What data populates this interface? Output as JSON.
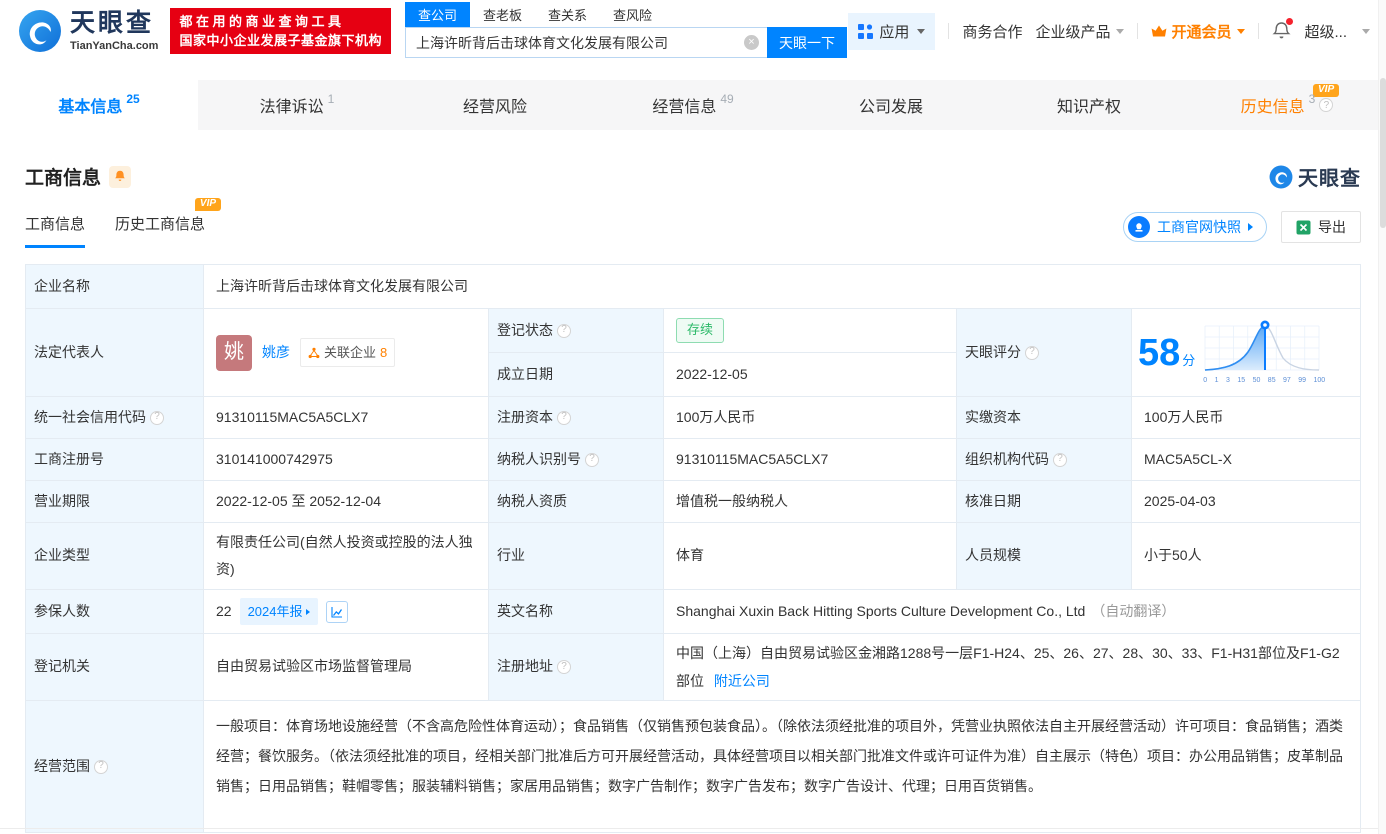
{
  "icons": {
    "help": "?",
    "clear": "×"
  },
  "badges": {
    "vip": "VIP"
  },
  "header": {
    "logo_title": "天眼查",
    "logo_domain": "TianYanCha.com",
    "banner_line1": "都在用的商业查询工具",
    "banner_line2": "国家中小企业发展子基金旗下机构",
    "search_tabs": [
      {
        "label": "查公司"
      },
      {
        "label": "查老板"
      },
      {
        "label": "查关系"
      },
      {
        "label": "查风险"
      }
    ],
    "search_value": "上海许昕背后击球体育文化发展有限公司",
    "search_button": "天眼一下",
    "nav_apps": "应用",
    "nav_business": "商务合作",
    "nav_enterprise": "企业级产品",
    "nav_vip": "开通会员",
    "nav_super": "超级..."
  },
  "tabs": [
    {
      "label": "基本信息",
      "count": "25"
    },
    {
      "label": "法律诉讼",
      "count": "1"
    },
    {
      "label": "经营风险",
      "count": ""
    },
    {
      "label": "经营信息",
      "count": "49"
    },
    {
      "label": "公司发展",
      "count": ""
    },
    {
      "label": "知识产权",
      "count": ""
    },
    {
      "label": "历史信息",
      "count": "3"
    }
  ],
  "section": {
    "title": "工商信息",
    "watermark": "天眼查",
    "subtab_active": "工商信息",
    "subtab_history": "历史工商信息",
    "snapshot_button": "工商官网快照",
    "export_button": "导出"
  },
  "table": {
    "company_name": {
      "label": "企业名称",
      "value": "上海许昕背后击球体育文化发展有限公司"
    },
    "legal_rep": {
      "label": "法定代表人",
      "avatar": "姚",
      "name": "姚彦",
      "related_label": "关联企业",
      "related_count": "8"
    },
    "reg_status": {
      "label": "登记状态",
      "value": "存续"
    },
    "establish_date": {
      "label": "成立日期",
      "value": "2022-12-05"
    },
    "score": {
      "label": "天眼评分",
      "value": "58",
      "unit": "分",
      "ticks": [
        "0",
        "1",
        "3",
        "15",
        "50",
        "85",
        "97",
        "99",
        "100"
      ]
    },
    "credit_code": {
      "label": "统一社会信用代码",
      "value": "91310115MAC5A5CLX7"
    },
    "reg_capital": {
      "label": "注册资本",
      "value": "100万人民币"
    },
    "paid_capital": {
      "label": "实缴资本",
      "value": "100万人民币"
    },
    "reg_number": {
      "label": "工商注册号",
      "value": "310141000742975"
    },
    "taxpayer_id": {
      "label": "纳税人识别号",
      "value": "91310115MAC5A5CLX7"
    },
    "org_code": {
      "label": "组织机构代码",
      "value": "MAC5A5CL-X"
    },
    "business_term": {
      "label": "营业期限",
      "value": "2022-12-05 至 2052-12-04"
    },
    "taxpayer_quality": {
      "label": "纳税人资质",
      "value": "增值税一般纳税人"
    },
    "approval_date": {
      "label": "核准日期",
      "value": "2025-04-03"
    },
    "company_type": {
      "label": "企业类型",
      "value": "有限责任公司(自然人投资或控股的法人独资)"
    },
    "industry": {
      "label": "行业",
      "value": "体育"
    },
    "staff_size": {
      "label": "人员规模",
      "value": "小于50人"
    },
    "insured": {
      "label": "参保人数",
      "value": "22",
      "report": "2024年报"
    },
    "english_name": {
      "label": "英文名称",
      "value": "Shanghai Xuxin Back Hitting Sports Culture Development Co., Ltd",
      "note": "（自动翻译）"
    },
    "reg_authority": {
      "label": "登记机关",
      "value": "自由贸易试验区市场监督管理局"
    },
    "reg_address": {
      "label": "注册地址",
      "value": "中国（上海）自由贸易试验区金湘路1288号一层F1-H24、25、26、27、28、30、33、F1-H31部位及F1-G2部位",
      "link": "附近公司"
    },
    "business_scope": {
      "label": "经营范围",
      "value": "一般项目：体育场地设施经营（不含高危险性体育运动）；食品销售（仅销售预包装食品）。（除依法须经批准的项目外，凭营业执照依法自主开展经营活动）许可项目：食品销售；酒类经营；餐饮服务。（依法须经批准的项目，经相关部门批准后方可开展经营活动，具体经营项目以相关部门批准文件或许可证件为准）自主展示（特色）项目：办公用品销售；皮革制品销售；日用品销售；鞋帽零售；服装辅料销售；家居用品销售；数字广告制作；数字广告发布；数字广告设计、代理；日用百货销售。"
    }
  }
}
